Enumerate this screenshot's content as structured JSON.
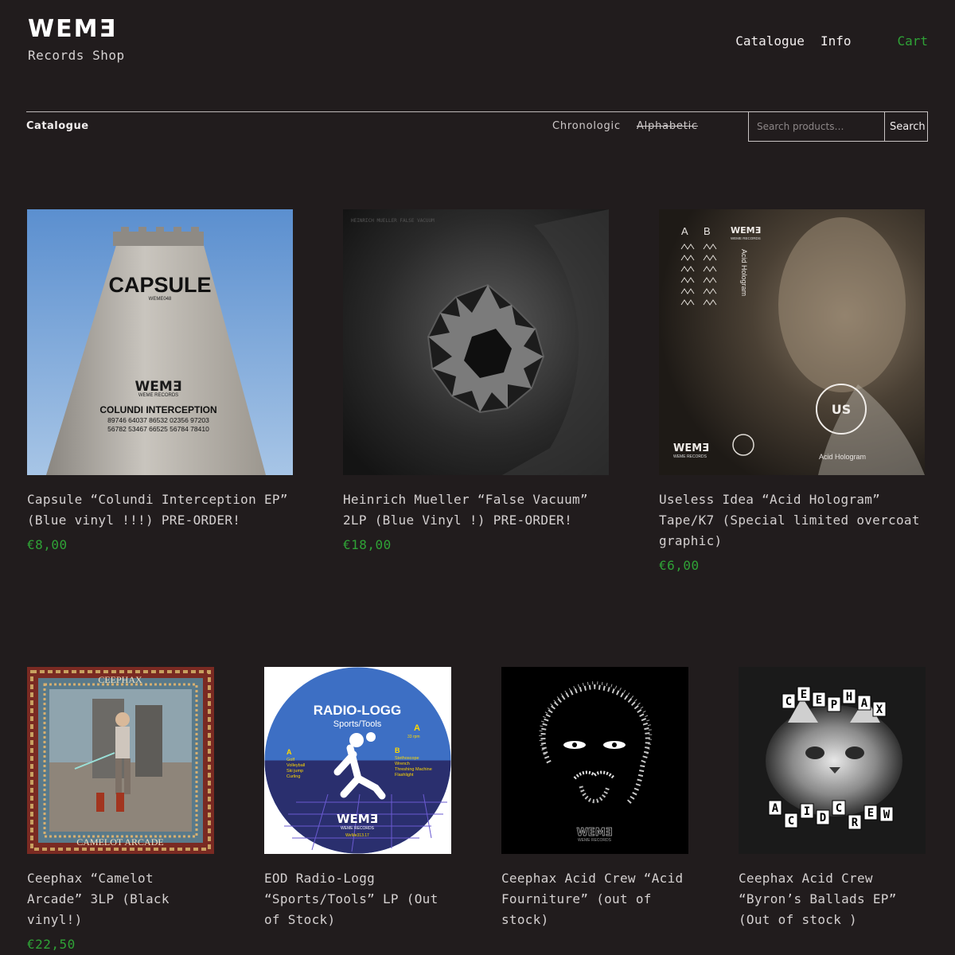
{
  "brand": {
    "logo": "WEMƎ",
    "subtitle": "Records Shop"
  },
  "nav": {
    "catalogue": "Catalogue",
    "info": "Info",
    "cart": "Cart"
  },
  "toolbar": {
    "title": "Catalogue",
    "sort_chronologic": "Chronologic",
    "sort_alphabetic": "Alphabetic",
    "search_placeholder": "Search products…",
    "search_button": "Search"
  },
  "products": [
    {
      "title": "Capsule “Colundi Interception EP” (Blue vinyl !!!) PRE-ORDER!",
      "price": "€8,00",
      "cover": {
        "heading": "CAPSULE",
        "code": "WEME048",
        "label": "WEMƎ",
        "label_sub": "WEME RECORDS",
        "subtitle": "COLUNDI INTERCEPTION",
        "numbers_1": "89746 64037 86532 02356 97203",
        "numbers_2": "56782 53467 66525 56784 78410"
      }
    },
    {
      "title": "Heinrich Mueller “False Vacuum” 2LP (Blue Vinyl !) PRE-ORDER!",
      "price": "€18,00",
      "cover": {
        "caption": "HEINRICH MUELLER    FALSE VACUUM"
      }
    },
    {
      "title": "Useless Idea “Acid Hologram” Tape/K7 (Special limited overcoat graphic)",
      "price": "€6,00",
      "cover": {
        "side_a": "A",
        "side_b": "B",
        "label": "WEMƎ",
        "label_sub": "WEME RECORDS",
        "vertical_title": "Acid Hologram",
        "bottom_title": "Acid Hologram",
        "badge": "US"
      }
    },
    {
      "title": "Ceephax “Camelot Arcade” 3LP (Black vinyl!)",
      "price": "€22,50",
      "cover": {
        "top": "CEEPHAX",
        "bottom": "CAMELOT ARCADE"
      }
    },
    {
      "title": "EOD Radio-Logg “Sports/Tools” LP (Out of Stock)",
      "price": "",
      "cover": {
        "heading": "RADIO-LOGG",
        "sub": "Sports/Tools",
        "side_a": "A",
        "rpm": "33 rpm",
        "a_label": "A",
        "a_tracks": [
          "Golf",
          "Volleyball",
          "Ski jump",
          "Curling"
        ],
        "b_label": "B",
        "b_tracks": [
          "Stethoscope",
          "Wrench",
          "Threshing Machine",
          "Flashlight"
        ],
        "label": "WEMƎ",
        "label_sub": "WEME RECORDS",
        "cat": "WeMe313.17"
      }
    },
    {
      "title": "Ceephax Acid Crew “Acid Fourniture” (out of stock)",
      "price": "",
      "cover": {
        "label": "WEMƎ",
        "label_sub": "WEME RECORDS"
      }
    },
    {
      "title": "Ceephax Acid Crew “Byron’s Ballads EP” (Out of stock )",
      "price": "",
      "cover": {
        "letters_top": [
          "C",
          "E",
          "E",
          "P",
          "H",
          "A",
          "X"
        ],
        "letters_bottom": [
          "A",
          "C",
          "I",
          "D",
          "C",
          "R",
          "E",
          "W"
        ]
      }
    }
  ]
}
